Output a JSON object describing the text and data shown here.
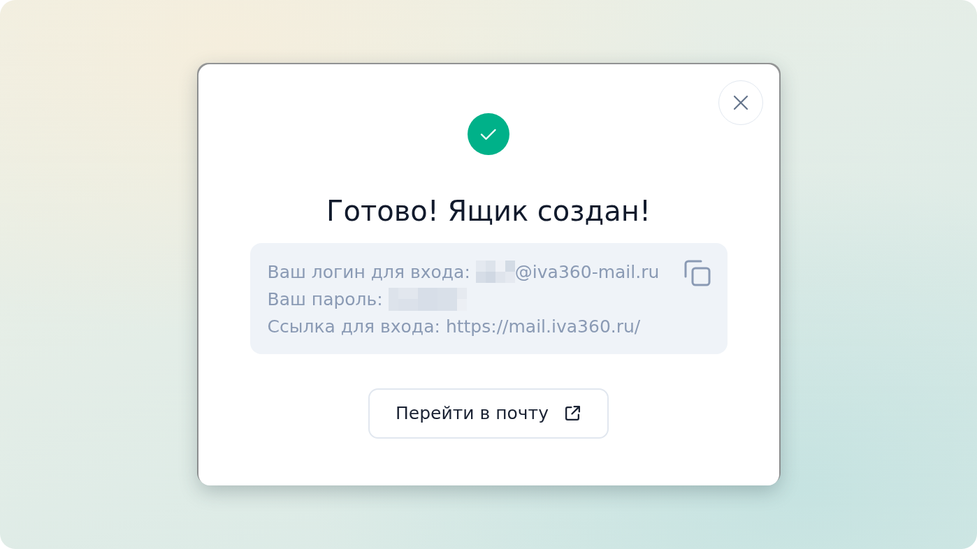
{
  "dialog": {
    "title": "Готово! Ящик создан!",
    "credentials": [
      {
        "label": "Ваш логин для входа:",
        "redacted": true,
        "value": "@iva360-mail.ru"
      },
      {
        "label": "Ваш пароль:",
        "redacted": true
      },
      {
        "label": "Ссылка для входа:",
        "redacted": false,
        "value": "https://mail.iva360.ru/"
      }
    ],
    "button": {
      "label": "Перейти в почту"
    }
  }
}
